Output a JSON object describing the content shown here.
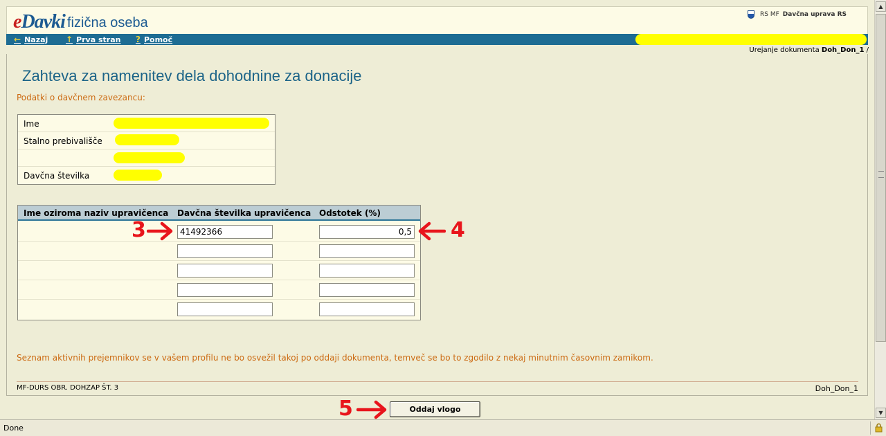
{
  "header": {
    "logo_e": "e",
    "logo_rest": "Davki",
    "subtitle": "fizična oseba",
    "gov_prefix": "RS MF",
    "gov_org": "Davčna uprava RS"
  },
  "nav": {
    "back": "Nazaj",
    "home": "Prva stran",
    "help": "Pomoč"
  },
  "breadcrumb": {
    "prefix": "Urejanje dokumenta",
    "doc": "Doh_Don_1",
    "sep": "/"
  },
  "page": {
    "title": "Zahteva za namenitev dela dohodnine za donacije",
    "section_label": "Podatki o davčnem zavezancu:"
  },
  "taxpayer": {
    "name_label": "Ime",
    "residence_label": "Stalno prebivališče",
    "tax_number_label": "Davčna številka"
  },
  "beneficiaries": {
    "col_name": "Ime oziroma naziv upravičenca",
    "col_tax": "Davčna številka upravičenca",
    "col_percent": "Odstotek (%)",
    "rows": [
      {
        "tax": "41492366",
        "percent": "0,5"
      },
      {
        "tax": "",
        "percent": ""
      },
      {
        "tax": "",
        "percent": ""
      },
      {
        "tax": "",
        "percent": ""
      },
      {
        "tax": "",
        "percent": ""
      }
    ]
  },
  "annotations": {
    "a3": "3",
    "a4": "4",
    "a5": "5"
  },
  "note": "Seznam aktivnih prejemnikov se v vašem profilu ne bo osvežil takoj po oddaji dokumenta, temveč se bo to zgodilo z nekaj minutnim časovnim zamikom.",
  "footer": {
    "form_code": "MF-DURS OBR. DOHZAP ŠT. 3",
    "doc_id": "Doh_Don_1"
  },
  "submit_label": "Oddaj vlogo",
  "status": {
    "text": "Done"
  },
  "colors": {
    "accent": "#1d6c93",
    "orange_text": "#cc6a12",
    "annotation_red": "#e8151c",
    "redaction": "#ffff00"
  }
}
